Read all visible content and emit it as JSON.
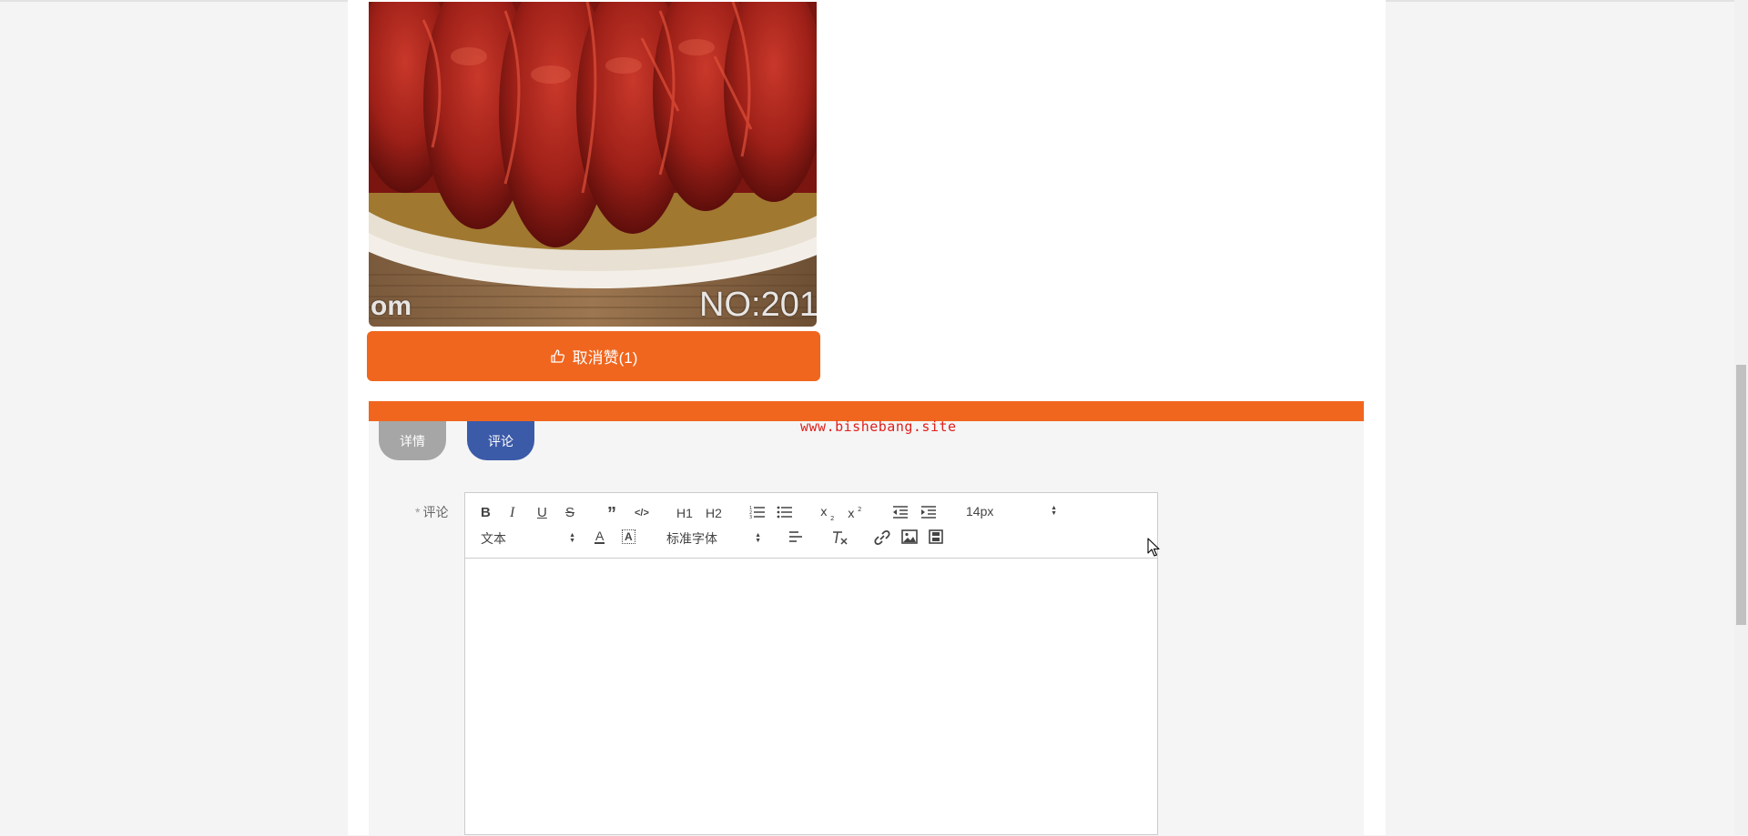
{
  "food_image": {
    "alt": "Crayfish dish photo",
    "watermark_left": "om",
    "watermark_right": "NO:201"
  },
  "like_button": {
    "icon": "thumbs-up-icon",
    "label": "取消赞(1)"
  },
  "watermark": "www.bishebang.site",
  "tabs": [
    {
      "label": "详情",
      "active": false
    },
    {
      "label": "评论",
      "active": true
    }
  ],
  "comment_form": {
    "required_mark": "*",
    "label": "评论"
  },
  "editor": {
    "toolbar": {
      "bold": "B",
      "italic": "I",
      "underline": "U",
      "strike": "S",
      "quote": "”",
      "code": "</>",
      "h1": "H1",
      "h2": "H2",
      "size_value": "14px",
      "header_value": "文本",
      "font_value": "标准字体",
      "color_letter": "A",
      "bg_letter": "A"
    },
    "body_value": ""
  },
  "colors": {
    "accent": "#f0661e",
    "tab_active": "#3b5aa8",
    "tab_inactive": "#a6a6a6",
    "watermark": "#e0201c"
  }
}
